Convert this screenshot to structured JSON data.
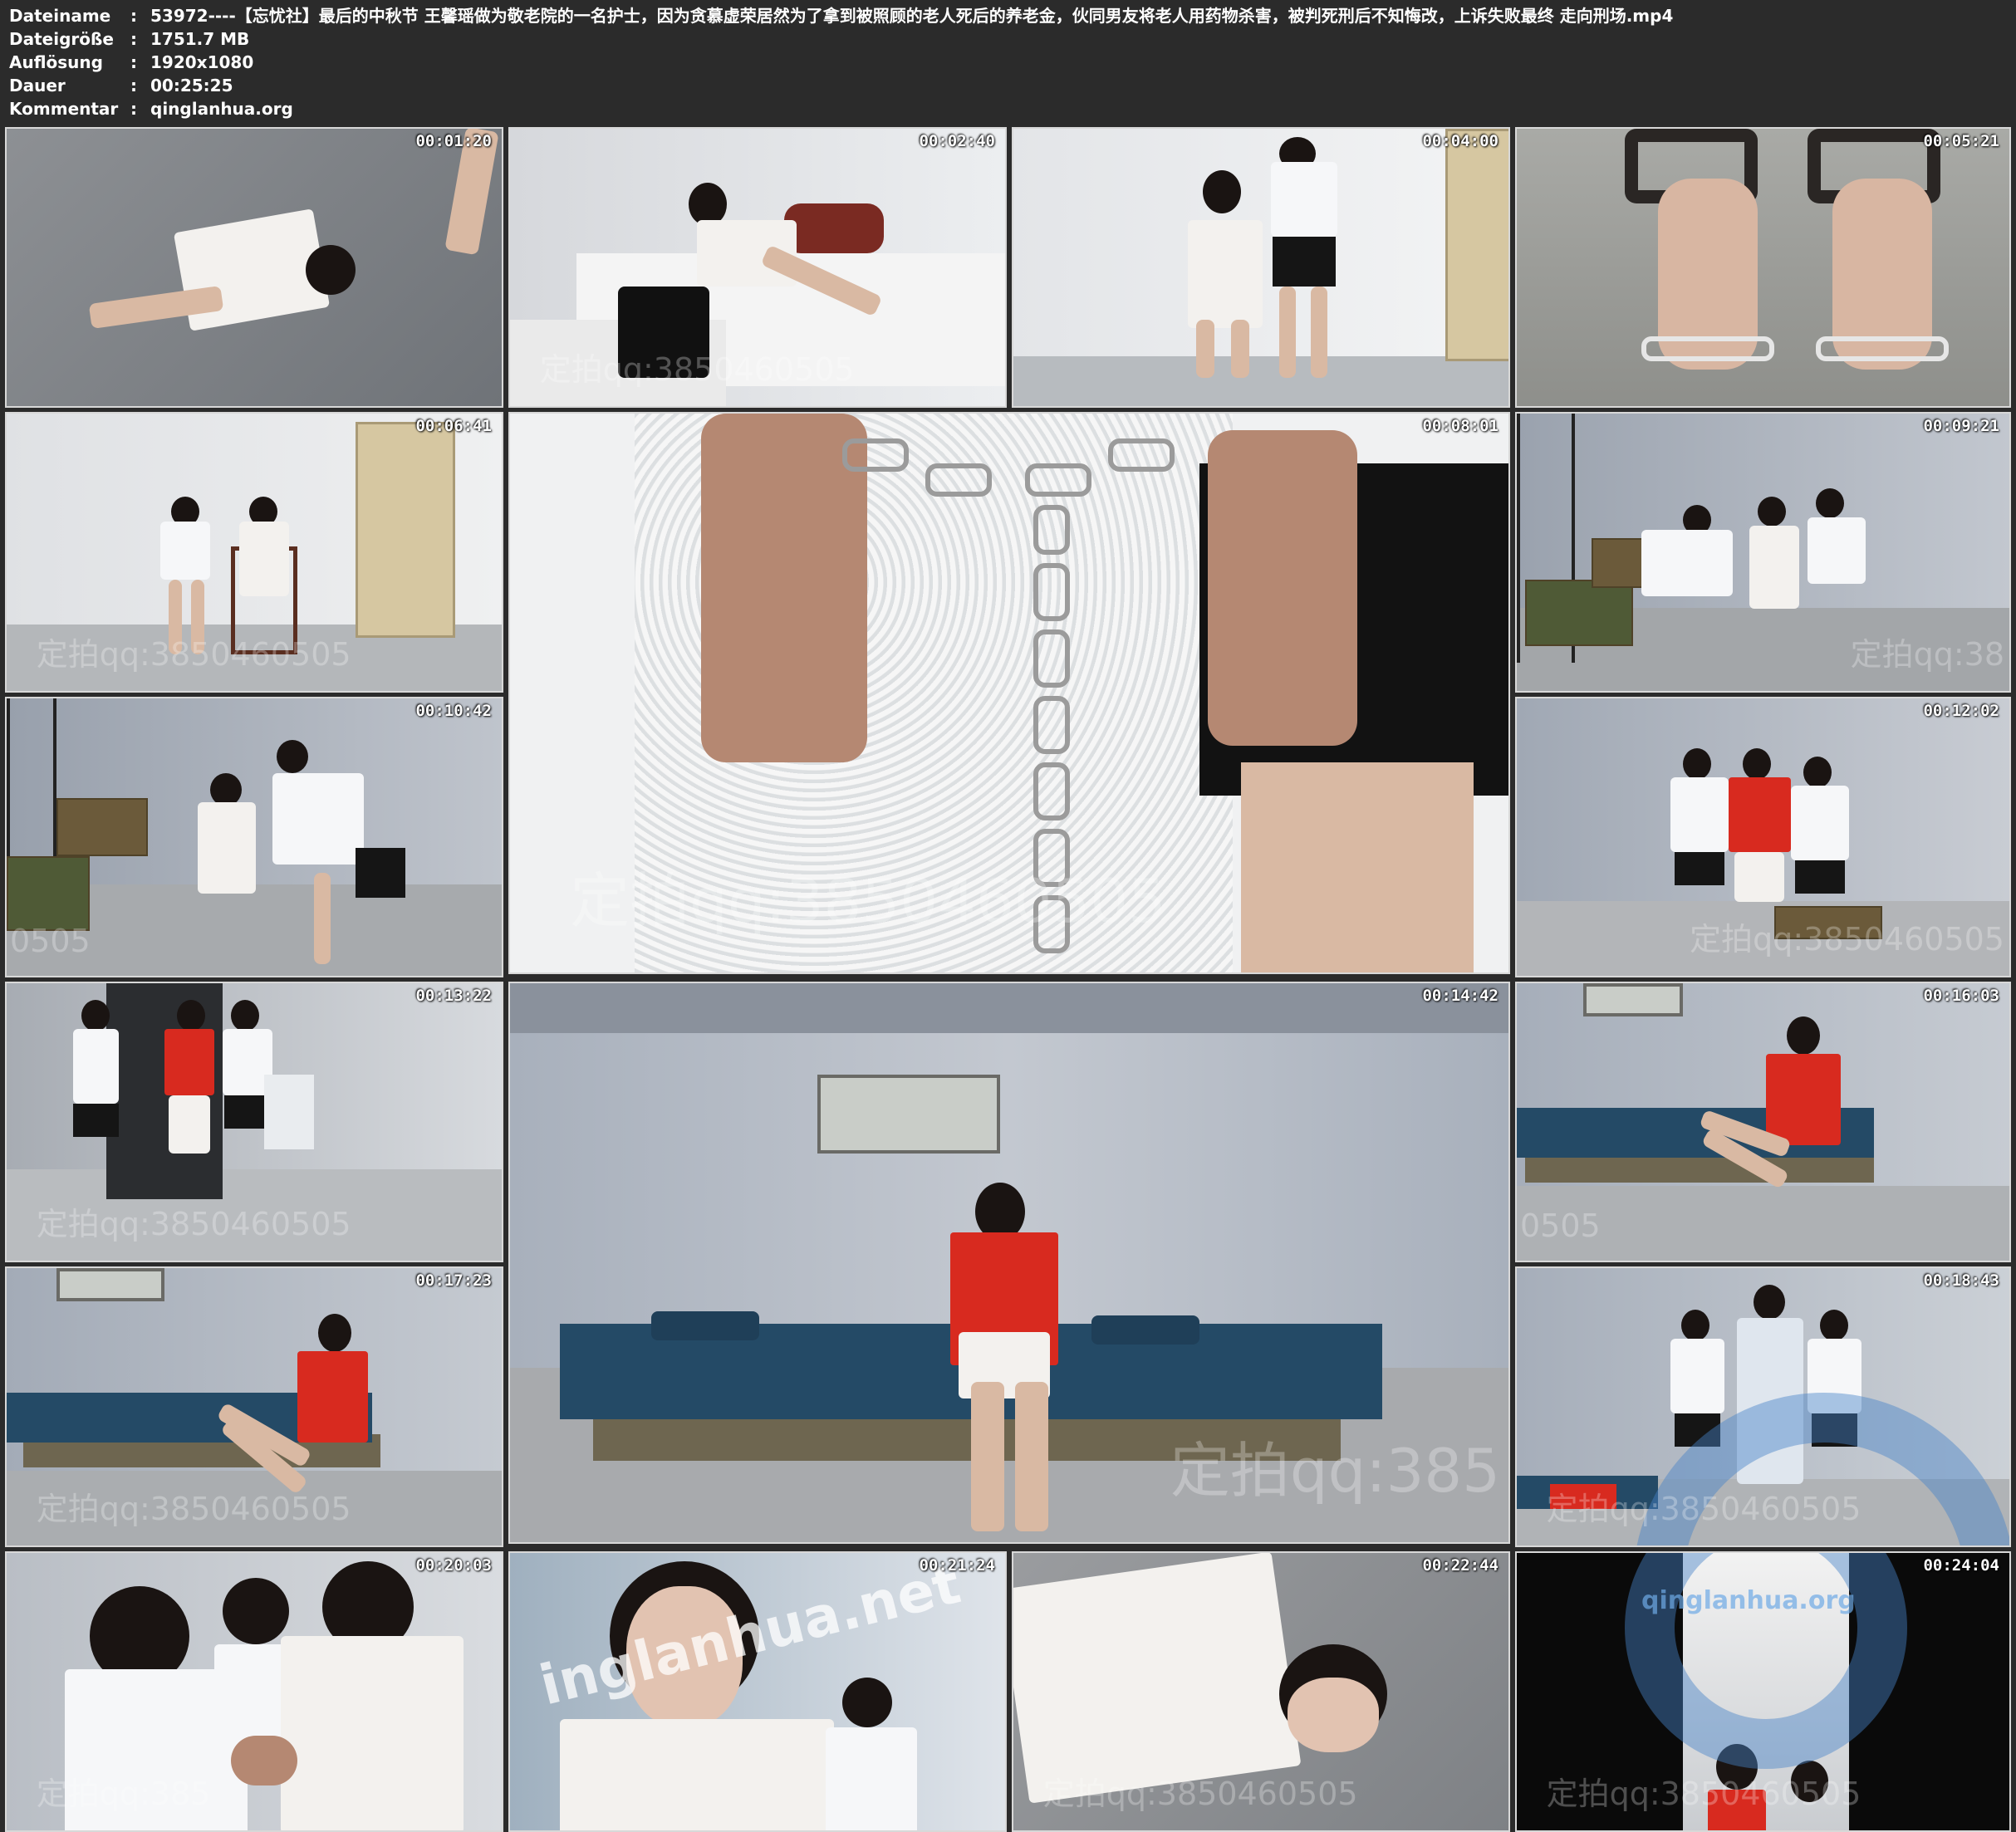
{
  "meta": {
    "rows": [
      {
        "key": "Dateiname",
        "sep": ":",
        "value": "53972----【忘忧社】最后的中秋节 王馨瑶做为敬老院的一名护士，因为贪慕虚荣居然为了拿到被照顾的老人死后的养老金，伙同男友将老人用药物杀害，被判死刑后不知悔改，上诉失败最终 走向刑场.mp4"
      },
      {
        "key": "Dateigröße",
        "sep": ":",
        "value": "1751.7 MB"
      },
      {
        "key": "Auflösung",
        "sep": ":",
        "value": "1920x1080"
      },
      {
        "key": "Dauer",
        "sep": ":",
        "value": "00:25:25"
      },
      {
        "key": "Kommentar",
        "sep": ":",
        "value": "qinglanhua.org"
      }
    ]
  },
  "thumbnails": [
    {
      "timestamp": "00:01:20",
      "watermark": ""
    },
    {
      "timestamp": "00:02:40",
      "watermark": "定拍qq:3850460505"
    },
    {
      "timestamp": "00:04:00",
      "watermark": ""
    },
    {
      "timestamp": "00:05:21",
      "watermark": ""
    },
    {
      "timestamp": "00:06:41",
      "watermark": "定拍qq:3850460505"
    },
    {
      "timestamp": "00:08:01",
      "watermark": "定拍qq:3850460505"
    },
    {
      "timestamp": "00:09:21",
      "watermark": "定拍qq:38"
    },
    {
      "timestamp": "00:10:42",
      "watermark": "0505"
    },
    {
      "timestamp": "00:12:02",
      "watermark": "定拍qq:3850460505"
    },
    {
      "timestamp": "00:13:22",
      "watermark": "定拍qq:3850460505"
    },
    {
      "timestamp": "00:14:42",
      "watermark": "定拍qq:385"
    },
    {
      "timestamp": "00:16:03",
      "watermark": "0505"
    },
    {
      "timestamp": "00:17:23",
      "watermark": "定拍qq:3850460505"
    },
    {
      "timestamp": "00:18:43",
      "watermark": "定拍qq:3850460505"
    },
    {
      "timestamp": "00:20:03",
      "watermark": "定拍qq:385"
    },
    {
      "timestamp": "00:21:24",
      "watermark": "inglanhua.net"
    },
    {
      "timestamp": "00:22:44",
      "watermark": "定拍qq:3850460505"
    },
    {
      "timestamp": "00:24:04",
      "watermark": "定拍qq:3850460505"
    }
  ],
  "logo_watermark": {
    "text": "qinglanhua.org"
  },
  "colors": {
    "background": "#2b2b2b",
    "header_text": "#ffffff",
    "frame_border": "#d8d8d8"
  }
}
